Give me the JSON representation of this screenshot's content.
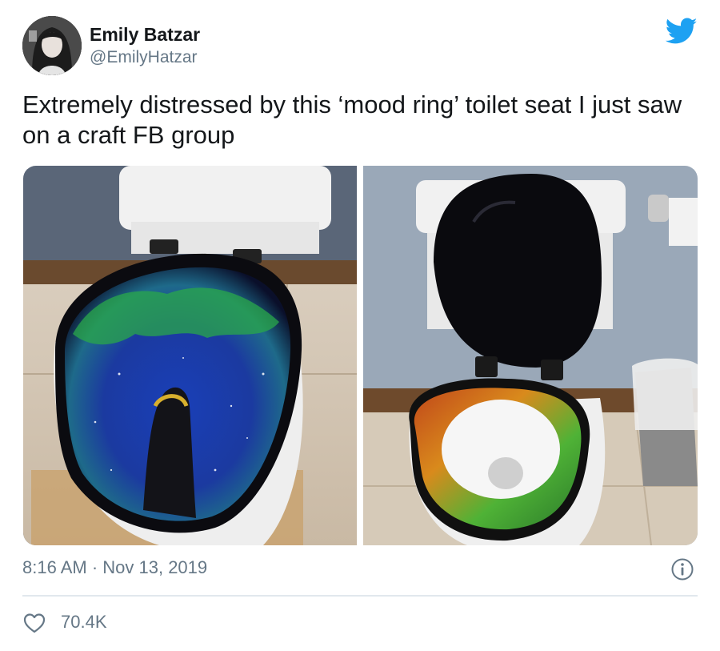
{
  "author": {
    "name": "Emily Batzar",
    "handle": "@EmilyHatzar",
    "avatar_icon": "avatar-photo"
  },
  "brand": {
    "icon": "twitter-bird-icon",
    "color": "#1da1f2"
  },
  "tweet": {
    "text": "Extremely distressed by this ‘mood ring’ toilet seat I just saw on a craft FB group",
    "timestamp": "8:16 AM · Nov 13, 2019"
  },
  "media": {
    "count": 2
  },
  "engagement": {
    "likes": "70.4K",
    "like_icon": "heart-outline-icon",
    "info_icon": "info-circle-icon"
  },
  "colors": {
    "text_primary": "#14171a",
    "text_secondary": "#657786",
    "divider": "#e1e8ed"
  }
}
